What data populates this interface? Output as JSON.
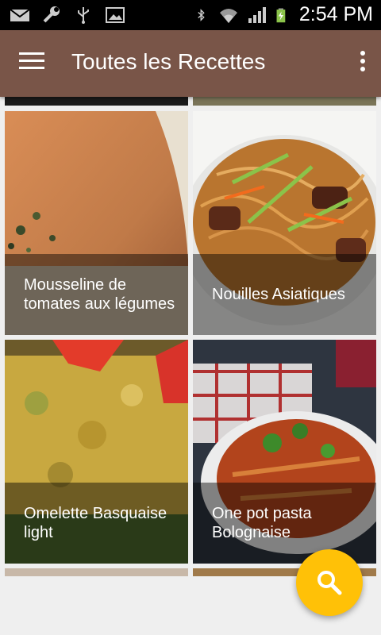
{
  "statusbar": {
    "time": "2:54 PM",
    "left_icons": [
      "mail-icon",
      "wrench-icon",
      "usb-icon",
      "image-icon"
    ],
    "right_icons": [
      "bluetooth-icon",
      "wifi-icon",
      "signal-icon",
      "battery-charging-icon"
    ]
  },
  "appbar": {
    "title": "Toutes les Recettes",
    "menu_icon": "hamburger-menu-icon",
    "overflow_icon": "more-vert-icon",
    "color": "#795548"
  },
  "recipes": [
    {
      "name": "Mousseline de tomates aux légumes"
    },
    {
      "name": "Nouilles Asiatiques"
    },
    {
      "name": "Omelette Basquaise light"
    },
    {
      "name": "One pot pasta Bolognaise"
    }
  ],
  "fab": {
    "icon": "search-icon",
    "color": "#ffc107"
  }
}
